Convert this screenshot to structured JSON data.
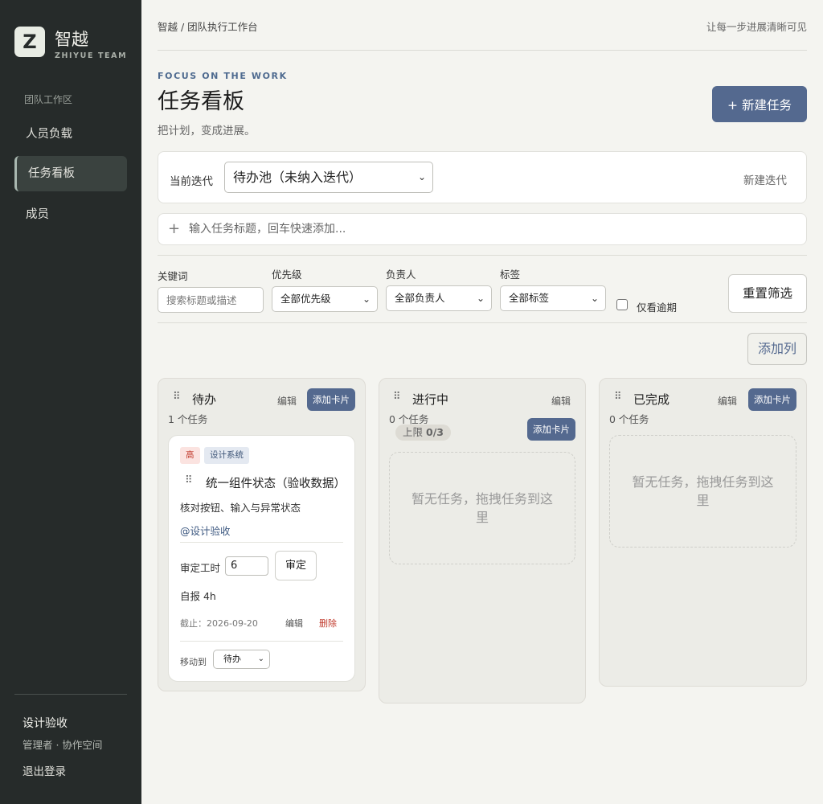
{
  "sidebar": {
    "logo_letter": "Z",
    "brand": "智越",
    "brand_sub": "ZHIYUE TEAM",
    "section_label": "团队工作区",
    "items": [
      {
        "label": "人员负载"
      },
      {
        "label": "任务看板",
        "active": true
      },
      {
        "label": "成员"
      }
    ],
    "user_name": "设计验收",
    "user_role": "管理者 · 协作空间",
    "logout": "退出登录"
  },
  "header": {
    "breadcrumb": "智越 / 团队执行工作台",
    "slogan": "让每一步进展清晰可见",
    "eyebrow": "FOCUS ON THE WORK",
    "title": "任务看板",
    "subtitle": "把计划，变成进展。",
    "new_task": "+ 新建任务"
  },
  "iteration": {
    "label": "当前迭代",
    "selected": "待办池（未纳入迭代）",
    "new_iteration": "新建迭代"
  },
  "quick_add": {
    "plus": "+",
    "placeholder": "输入任务标题，回车快速添加..."
  },
  "filters": {
    "keyword_label": "关键词",
    "keyword_placeholder": "搜索标题或描述",
    "priority_label": "优先级",
    "priority_value": "全部优先级",
    "assignee_label": "负责人",
    "assignee_value": "全部负责人",
    "tag_label": "标签",
    "tag_value": "全部标签",
    "overdue_label": "仅看逾期",
    "overdue_checked": false,
    "reset": "重置筛选"
  },
  "add_column": "添加列",
  "columns": [
    {
      "title": "待办",
      "edit": "编辑",
      "add_card": "添加卡片",
      "count": "1 个任务"
    },
    {
      "title": "进行中",
      "edit": "编辑",
      "add_card": "添加卡片",
      "count": "0 个任务",
      "limit_label": "上限",
      "limit_value": "0/3",
      "empty": "暂无任务，拖拽任务到这里"
    },
    {
      "title": "已完成",
      "edit": "编辑",
      "add_card": "添加卡片",
      "count": "0 个任务",
      "empty": "暂无任务，拖拽任务到这里"
    }
  ],
  "card": {
    "priority": "高",
    "tag": "设计系统",
    "title": "统一组件状态（验收数据）",
    "description": "核对按钮、输入与异常状态",
    "assignee": "@设计验收",
    "estimate_label": "审定工时",
    "estimate_value": "6",
    "estimate_button": "审定",
    "self_report": "自报 4h",
    "deadline": "截止：2026-09-20",
    "edit": "编辑",
    "delete": "删除",
    "move_label": "移动到",
    "move_value": "待办"
  },
  "colors": {
    "sidebar_bg": "#262b2a",
    "accent": "#54698f",
    "danger": "#c0392b",
    "page_bg": "#f4f4f0"
  },
  "icons": {
    "drag": "⠿",
    "chevron": "chevron-down-icon"
  }
}
